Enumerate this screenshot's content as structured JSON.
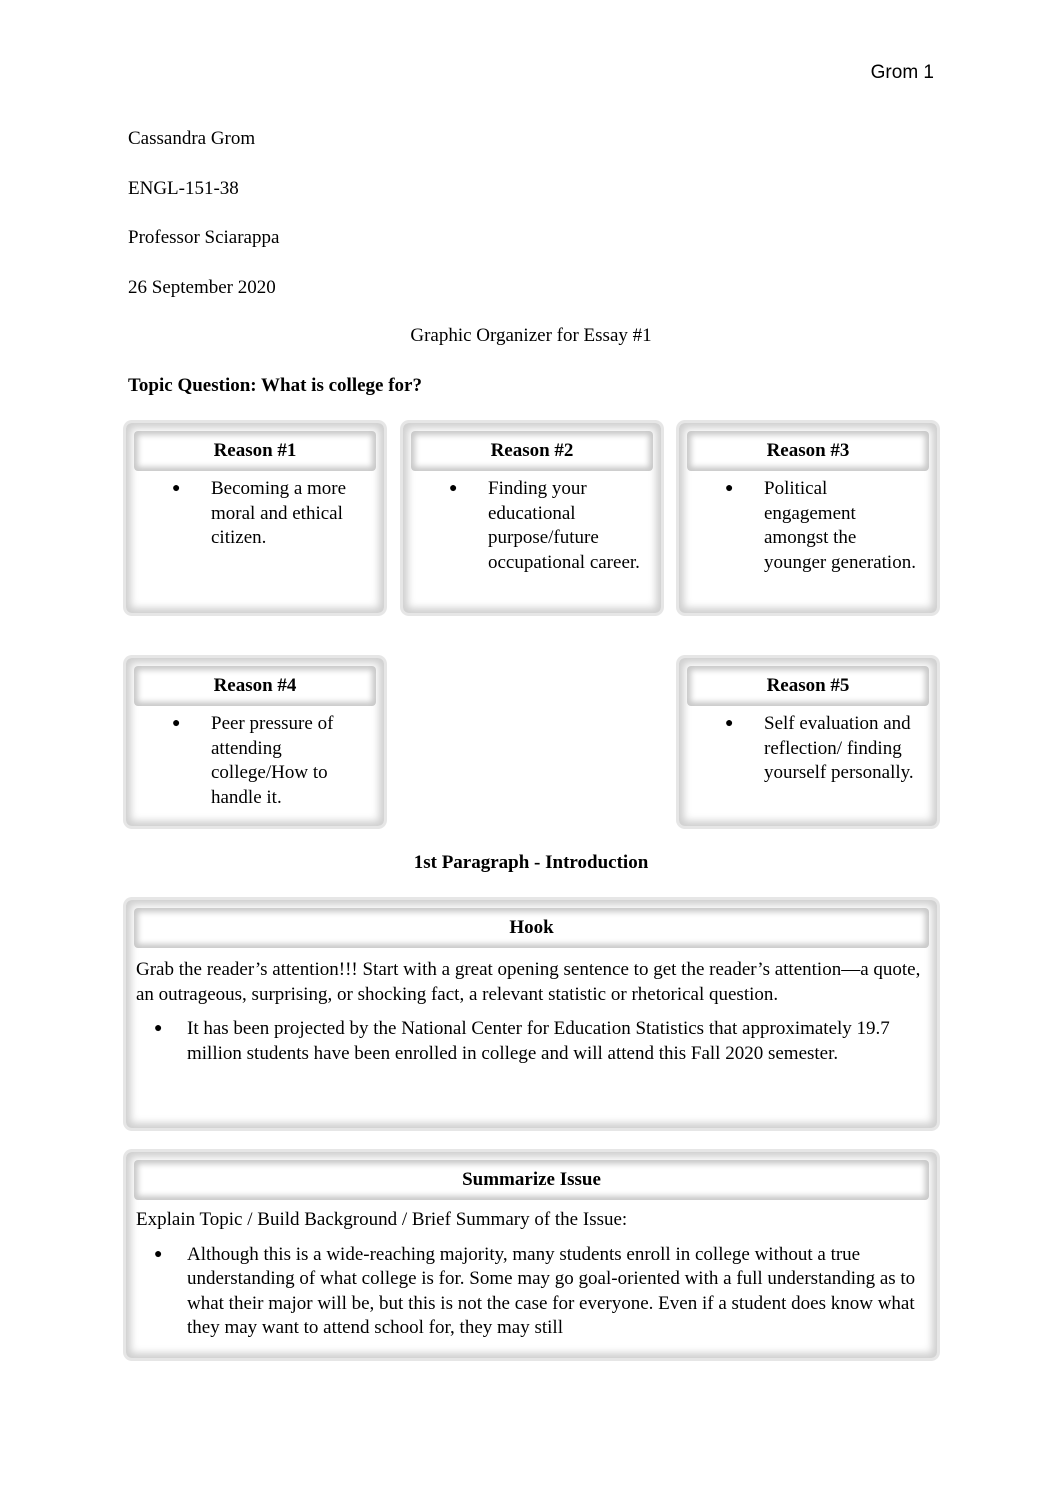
{
  "running_head": "Grom 1",
  "header": {
    "author": "Cassandra Grom",
    "course": "ENGL-151-38",
    "professor": "Professor Sciarappa",
    "date": "26 September 2020"
  },
  "title": "Graphic Organizer for Essay #1",
  "topic_question": "Topic Question: What is college for?",
  "reasons": [
    {
      "label": "Reason #1",
      "text": "Becoming a more moral and ethical citizen."
    },
    {
      "label": "Reason #2",
      "text": "Finding your educational purpose/future occupational career."
    },
    {
      "label": "Reason #3",
      "text": "Political engagement amongst the younger generation."
    },
    {
      "label": "Reason #4",
      "text": "Peer pressure of attending college/How to handle it."
    },
    {
      "label": "Reason #5",
      "text": "Self evaluation and reflection/ finding yourself personally."
    }
  ],
  "intro_section": "1st Paragraph - Introduction",
  "hook": {
    "label": "Hook",
    "prompt": "Grab the reader’s attention!!! Start with a great opening sentence to get the reader’s attention—a quote, an outrageous, surprising, or shocking fact, a relevant statistic or rhetorical question.",
    "bullet": "It has been projected by the National Center for Education Statistics that approximately 19.7 million students have been enrolled in college and will attend this Fall 2020 semester."
  },
  "summarize": {
    "label": "Summarize Issue",
    "prompt": "Explain Topic / Build Background / Brief Summary of the Issue:",
    "bullet": "Although this is a wide-reaching majority, many students enroll in college without a true understanding of what college is for. Some may go goal-oriented with a full understanding as to what their major will be, but this is not the case for everyone. Even if a student does know what they may want to attend school for, they may still"
  }
}
